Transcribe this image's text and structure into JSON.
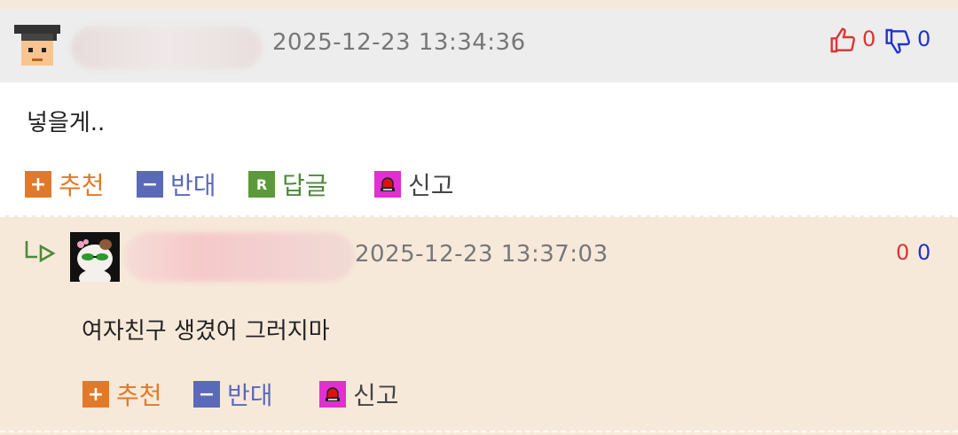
{
  "comments": [
    {
      "timestamp": "2025-12-23 13:34:36",
      "up_count": "0",
      "down_count": "0",
      "text": "넣을게..",
      "actions": {
        "recommend": "추천",
        "oppose": "반대",
        "reply": "답글",
        "report": "신고"
      }
    },
    {
      "timestamp": "2025-12-23 13:37:03",
      "up_count": "0",
      "down_count": "0",
      "text": "여자친구 생겼어 그러지마",
      "actions": {
        "recommend": "추천",
        "oppose": "반대",
        "report": "신고"
      }
    }
  ],
  "icons": {
    "plus": "+",
    "minus": "−",
    "reply_badge": "R",
    "reply_arrow": "reply-arrow-icon",
    "thumbs_up": "thumbs-up-icon",
    "thumbs_down": "thumbs-down-icon",
    "report": "siren-icon"
  },
  "colors": {
    "recommend": "#e07a2a",
    "oppose": "#5a6ab8",
    "reply": "#5a9a3a",
    "report": "#e22fd0",
    "up": "#dd3333",
    "down": "#2233cc"
  }
}
